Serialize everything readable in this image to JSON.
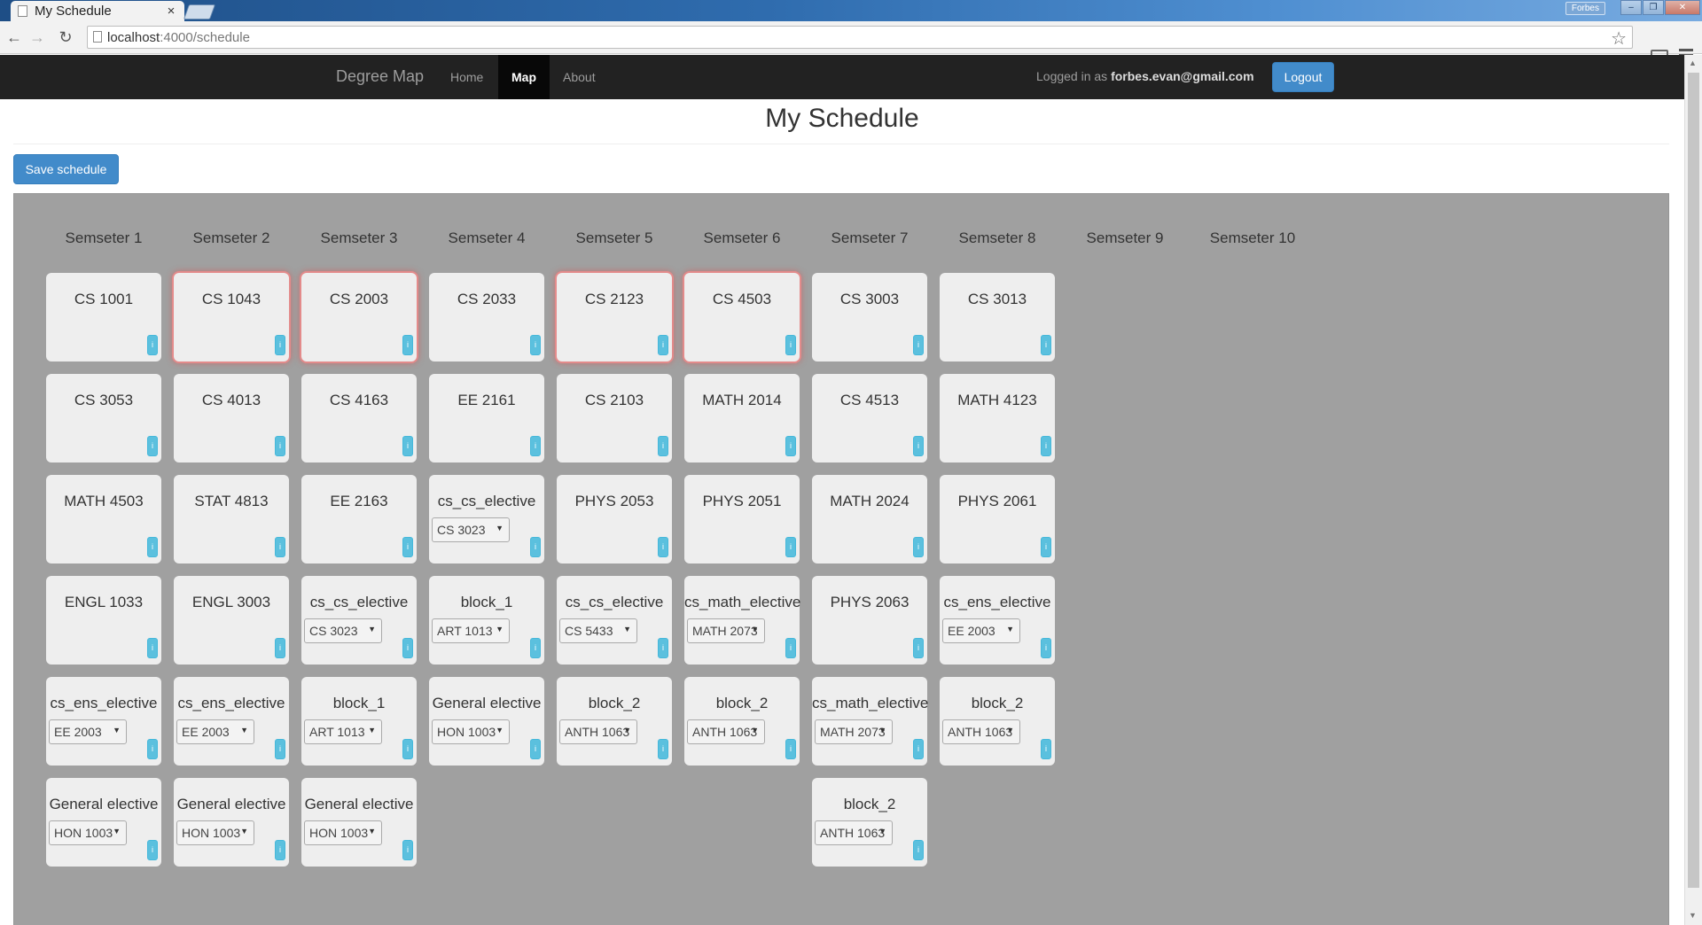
{
  "browser": {
    "tab_title": "My Schedule",
    "tab_close": "×",
    "window_user": "Forbes",
    "url_host": "localhost",
    "url_path": ":4000/schedule"
  },
  "navbar": {
    "brand": "Degree Map",
    "links": [
      {
        "label": "Home",
        "active": false
      },
      {
        "label": "Map",
        "active": true
      },
      {
        "label": "About",
        "active": false
      }
    ],
    "logged_in_prefix": "Logged in as ",
    "user_email": "forbes.evan@gmail.com",
    "logout_label": "Logout"
  },
  "page": {
    "title": "My Schedule",
    "save_label": "Save schedule"
  },
  "colors": {
    "board_bg": "#a0a0a0",
    "card_bg": "#eeeeee",
    "flag_glow": "#e38b8b",
    "primary_button": "#428bca",
    "info_button": "#5bc0de"
  },
  "icons": {
    "back": "back-arrow-icon",
    "forward": "forward-arrow-icon",
    "reload": "reload-icon",
    "star": "bookmark-star-icon",
    "cast": "cast-icon",
    "menu": "menu-icon",
    "info": "info-icon"
  },
  "info_glyph": "i",
  "semesters": [
    {
      "label": "Semseter 1",
      "courses": [
        {
          "name": "CS 1001"
        },
        {
          "name": "CS 3053"
        },
        {
          "name": "MATH 4503"
        },
        {
          "name": "ENGL 1033"
        },
        {
          "name": "cs_ens_elective",
          "select": "EE 2003"
        },
        {
          "name": "General elective",
          "select": "HON 1003"
        }
      ]
    },
    {
      "label": "Semseter 2",
      "courses": [
        {
          "name": "CS 1043",
          "flag": true
        },
        {
          "name": "CS 4013"
        },
        {
          "name": "STAT 4813"
        },
        {
          "name": "ENGL 3003"
        },
        {
          "name": "cs_ens_elective",
          "select": "EE 2003"
        },
        {
          "name": "General elective",
          "select": "HON 1003"
        }
      ]
    },
    {
      "label": "Semseter 3",
      "courses": [
        {
          "name": "CS 2003",
          "flag": true
        },
        {
          "name": "CS 4163"
        },
        {
          "name": "EE 2163"
        },
        {
          "name": "cs_cs_elective",
          "select": "CS 3023"
        },
        {
          "name": "block_1",
          "select": "ART 1013"
        },
        {
          "name": "General elective",
          "select": "HON 1003"
        }
      ]
    },
    {
      "label": "Semseter 4",
      "courses": [
        {
          "name": "CS 2033"
        },
        {
          "name": "EE 2161"
        },
        {
          "name": "cs_cs_elective",
          "select": "CS 3023"
        },
        {
          "name": "block_1",
          "select": "ART 1013"
        },
        {
          "name": "General elective",
          "select": "HON 1003"
        }
      ]
    },
    {
      "label": "Semseter 5",
      "courses": [
        {
          "name": "CS 2123",
          "flag": true
        },
        {
          "name": "CS 2103"
        },
        {
          "name": "PHYS 2053"
        },
        {
          "name": "cs_cs_elective",
          "select": "CS 5433"
        },
        {
          "name": "block_2",
          "select": "ANTH 1063"
        }
      ]
    },
    {
      "label": "Semseter 6",
      "courses": [
        {
          "name": "CS 4503",
          "flag": true
        },
        {
          "name": "MATH 2014"
        },
        {
          "name": "PHYS 2051"
        },
        {
          "name": "cs_math_elective",
          "select": "MATH 2073"
        },
        {
          "name": "block_2",
          "select": "ANTH 1063"
        }
      ]
    },
    {
      "label": "Semseter 7",
      "courses": [
        {
          "name": "CS 3003"
        },
        {
          "name": "CS 4513"
        },
        {
          "name": "MATH 2024"
        },
        {
          "name": "PHYS 2063"
        },
        {
          "name": "cs_math_elective",
          "select": "MATH 2073"
        },
        {
          "name": "block_2",
          "select": "ANTH 1063"
        }
      ]
    },
    {
      "label": "Semseter 8",
      "courses": [
        {
          "name": "CS 3013"
        },
        {
          "name": "MATH 4123"
        },
        {
          "name": "PHYS 2061"
        },
        {
          "name": "cs_ens_elective",
          "select": "EE 2003"
        },
        {
          "name": "block_2",
          "select": "ANTH 1063"
        }
      ]
    },
    {
      "label": "Semseter 9",
      "courses": []
    },
    {
      "label": "Semseter 10",
      "courses": []
    }
  ]
}
